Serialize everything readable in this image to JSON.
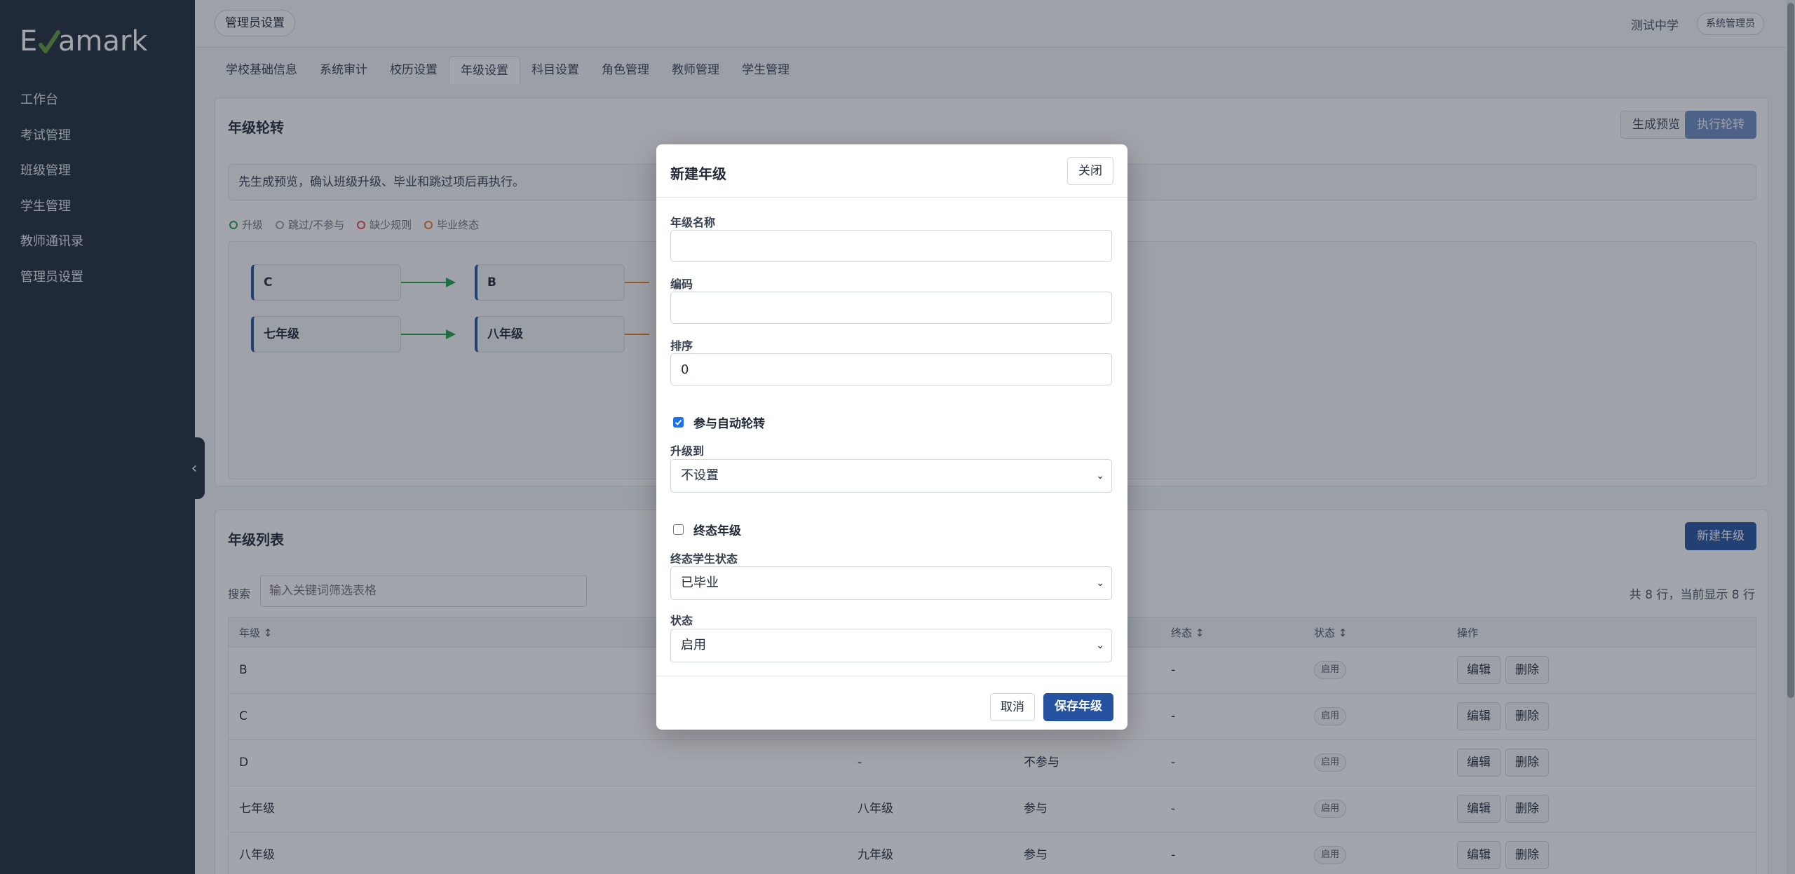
{
  "brand": {
    "logo_text": "Examark",
    "accent": "#2451a0",
    "check_color": "#5b9b3b"
  },
  "sidebar": {
    "items": [
      {
        "label": "工作台"
      },
      {
        "label": "考试管理"
      },
      {
        "label": "班级管理"
      },
      {
        "label": "学生管理"
      },
      {
        "label": "教师通讯录"
      },
      {
        "label": "管理员设置"
      }
    ],
    "collapse_icon": "chevron-left-icon"
  },
  "header": {
    "page_chip": "管理员设置",
    "school": "测试中学",
    "role": "系统管理员"
  },
  "tabs": [
    {
      "label": "学校基础信息",
      "active": false
    },
    {
      "label": "系统审计",
      "active": false
    },
    {
      "label": "校历设置",
      "active": false
    },
    {
      "label": "年级设置",
      "active": true
    },
    {
      "label": "科目设置",
      "active": false
    },
    {
      "label": "角色管理",
      "active": false
    },
    {
      "label": "教师管理",
      "active": false
    },
    {
      "label": "学生管理",
      "active": false
    }
  ],
  "rotation": {
    "title": "年级轮转",
    "preview_label": "生成预览",
    "execute_label": "执行轮转",
    "notice": "先生成预览，确认班级升级、毕业和跳过项后再执行。",
    "legend": [
      {
        "label": "升级",
        "color": "#22a04a"
      },
      {
        "label": "跳过/不参与",
        "color": "#9ca3af"
      },
      {
        "label": "缺少规则",
        "color": "#e5484d"
      },
      {
        "label": "毕业终态",
        "color": "#ea7a2e"
      }
    ],
    "flows": [
      {
        "from": "C",
        "to": "B"
      },
      {
        "from": "七年级",
        "to": "八年级"
      }
    ]
  },
  "grade_list": {
    "title": "年级列表",
    "new_label": "新建年级",
    "search_label": "搜索",
    "search_placeholder": "输入关键词筛选表格",
    "row_count": "共 8 行，当前显示 8 行",
    "columns": {
      "grade": "年级 ↕",
      "final": "终态 ↕",
      "status": "状态 ↕",
      "actions": "操作"
    },
    "rows": [
      {
        "grade": "B",
        "next": "",
        "participate": "",
        "final": "-",
        "status": "启用"
      },
      {
        "grade": "C",
        "next": "",
        "participate": "",
        "final": "-",
        "status": "启用"
      },
      {
        "grade": "D",
        "next": "-",
        "participate": "不参与",
        "final": "-",
        "status": "启用"
      },
      {
        "grade": "七年级",
        "next": "八年级",
        "participate": "参与",
        "final": "-",
        "status": "启用"
      },
      {
        "grade": "八年级",
        "next": "九年级",
        "participate": "参与",
        "final": "-",
        "status": "启用"
      }
    ],
    "edit_label": "编辑",
    "delete_label": "删除"
  },
  "modal": {
    "title": "新建年级",
    "close_label": "关闭",
    "name_label": "年级名称",
    "name_value": "",
    "code_label": "编码",
    "code_value": "",
    "order_label": "排序",
    "order_value": "0",
    "auto_rotate_label": "参与自动轮转",
    "auto_rotate_checked": true,
    "upgrade_to_label": "升级到",
    "upgrade_to_value": "不设置",
    "final_grade_label": "终态年级",
    "final_grade_checked": false,
    "final_status_label": "终态学生状态",
    "final_status_value": "已毕业",
    "status_label": "状态",
    "status_value": "启用",
    "cancel_label": "取消",
    "save_label": "保存年级"
  }
}
